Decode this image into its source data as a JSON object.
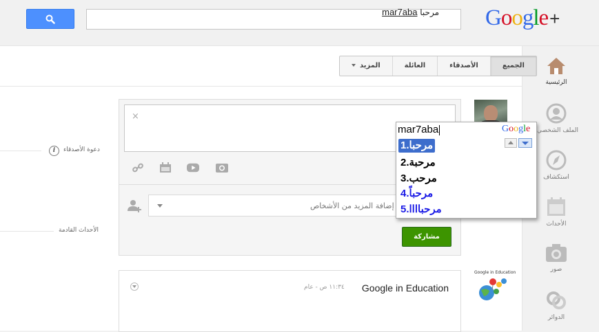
{
  "header": {
    "search_placeholder": "",
    "logo_text": "Google",
    "logo_plus": "+",
    "logo_colors": [
      "#3369e8",
      "#d50f25",
      "#eeb211",
      "#3369e8",
      "#009925",
      "#d50f25"
    ]
  },
  "tabs": [
    {
      "label": "الجميع",
      "active": true
    },
    {
      "label": "الأصدقاء",
      "active": false
    },
    {
      "label": "العائلة",
      "active": false
    },
    {
      "label": "المزيد",
      "active": false,
      "dropdown": true
    }
  ],
  "side": {
    "invite_friends": "دعوة الأصدقاء",
    "upcoming_events": "الأحداث القادمة"
  },
  "composer": {
    "text_arabic": "مرحبا",
    "text_latin": "mar7aba",
    "close_icon": "×",
    "tools": [
      "link-icon",
      "event-icon",
      "video-icon",
      "photo-icon"
    ]
  },
  "suggest": {
    "input": "mar7aba",
    "logo": "Google",
    "items": [
      {
        "text": "1.مرحبا",
        "style": "selected"
      },
      {
        "text": "2.مرحبة",
        "style": "black"
      },
      {
        "text": "3.مرحب",
        "style": "black"
      },
      {
        "text": "4.مرحباً",
        "style": "blue"
      },
      {
        "text": "5.مرحباااا",
        "style": "blue"
      }
    ]
  },
  "share": {
    "add_people_placeholder": "+ إضافة المزيد من الأشخاص",
    "share_button": "مشاركة",
    "share_button_color": "#3d9400"
  },
  "post": {
    "author": "Google in Education",
    "meta": "١١:٣٤ ص - عام",
    "avatar_label": "Google in Education"
  },
  "nav": [
    {
      "label": "الرئيسية",
      "icon": "home-icon",
      "active": true
    },
    {
      "label": "الملف الشخصي",
      "icon": "profile-icon",
      "active": false
    },
    {
      "label": "استكشاف",
      "icon": "compass-icon",
      "active": false
    },
    {
      "label": "الأحداث",
      "icon": "calendar-icon",
      "active": false
    },
    {
      "label": "صور",
      "icon": "camera-icon",
      "active": false
    },
    {
      "label": "الدوائر",
      "icon": "circles-icon",
      "active": false
    }
  ]
}
